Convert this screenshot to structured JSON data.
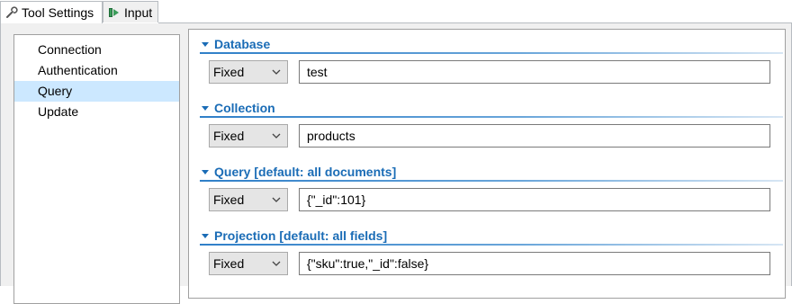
{
  "tabs": [
    {
      "label": "Tool Settings",
      "icon": "wrench-icon",
      "active": true
    },
    {
      "label": "Input",
      "icon": "input-arrow-icon",
      "active": false
    }
  ],
  "sidebar": {
    "items": [
      {
        "label": "Connection",
        "selected": false
      },
      {
        "label": "Authentication",
        "selected": false
      },
      {
        "label": "Query",
        "selected": true
      },
      {
        "label": "Update",
        "selected": false
      }
    ]
  },
  "sections": [
    {
      "title": "Database",
      "mode": "Fixed",
      "value": "test"
    },
    {
      "title": "Collection",
      "mode": "Fixed",
      "value": "products"
    },
    {
      "title": "Query [default: all documents]",
      "mode": "Fixed",
      "value": "{\"_id\":101}"
    },
    {
      "title": "Projection [default: all fields]",
      "mode": "Fixed",
      "value": "{\"sku\":true,\"_id\":false}"
    }
  ],
  "colors": {
    "accent": "#1a6cb6",
    "selection": "#cce8ff"
  }
}
